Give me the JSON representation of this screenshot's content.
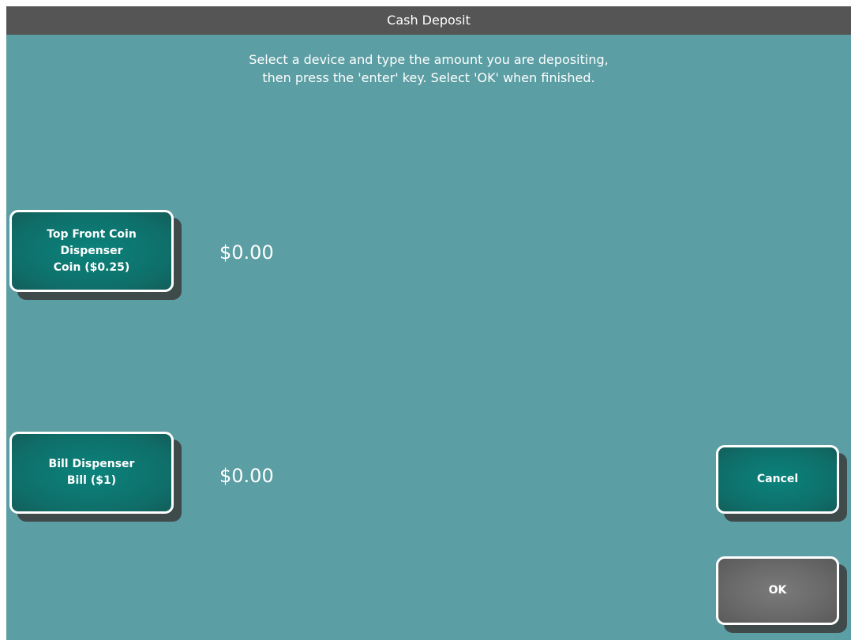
{
  "window": {
    "title": "Cash Deposit"
  },
  "instructions": {
    "line1": "Select a device and type the amount you are depositing,",
    "line2": "then press the 'enter' key.  Select 'OK' when finished."
  },
  "devices": [
    {
      "label_lines": [
        "Top Front Coin",
        "Dispenser",
        "Coin ($0.25)"
      ],
      "amount": "$0.00"
    },
    {
      "label_lines": [
        "Bill Dispenser",
        "Bill ($1)"
      ],
      "amount": "$0.00"
    }
  ],
  "actions": {
    "cancel_label": "Cancel",
    "ok_label": "OK"
  },
  "colors": {
    "background": "#5b9ea4",
    "titlebar": "#555555",
    "device_button": "#0f6e69",
    "ok_button": "#6a6a6a",
    "text": "#ffffff"
  }
}
